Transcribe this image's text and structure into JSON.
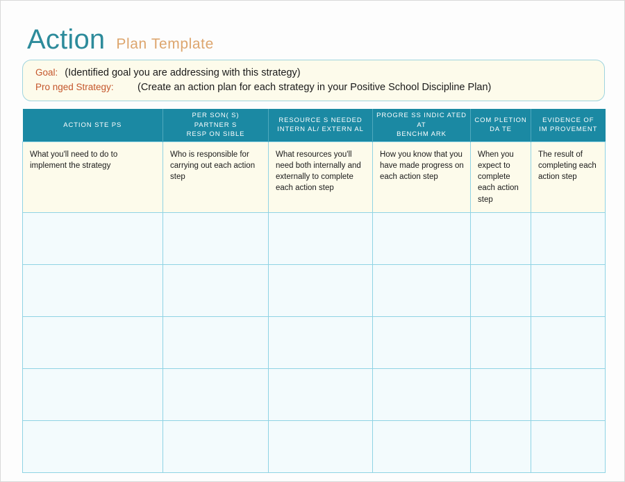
{
  "title": {
    "main": "Action",
    "sub": "Plan  Template"
  },
  "goal": {
    "goal_label": "Goal:",
    "goal_text": "(Identified goal you are addressing with this strategy)",
    "strategy_label": "Pro nged Strategy:",
    "strategy_text": "(Create an action plan for each strategy in your Positive School Discipline Plan)"
  },
  "table": {
    "headers": [
      {
        "lines": [
          "ACTION STE  PS"
        ]
      },
      {
        "lines": [
          "PER SON( S)",
          "PARTNER  S",
          "RESP ON SIBLE"
        ]
      },
      {
        "lines": [
          "RESOURCE  S NEEDED",
          "INTERN  AL/ EXTERN  AL"
        ]
      },
      {
        "lines": [
          "PROGRE  SS INDIC ATED  AT",
          "BENCHM  ARK"
        ]
      },
      {
        "lines": [
          "COM PLETION",
          "DA TE"
        ]
      },
      {
        "lines": [
          "EVIDENCE OF",
          "IM PROVEMENT"
        ]
      }
    ],
    "description_row": [
      "What you'll need to do to implement the strategy",
      "Who is responsible for carrying out each action step",
      "What resources you'll need both internally and externally to complete each action step",
      "How you know that you have made progress on each action step",
      "When you expect to complete each action step",
      "The result of completing each action step"
    ],
    "empty_row_count": 5,
    "column_count": 6
  },
  "colors": {
    "header_teal": "#1b89a3",
    "title_teal": "#2d8b9b",
    "title_orange": "#dda56d",
    "label_orange": "#c4552a",
    "cream": "#fdfbeb",
    "pale_blue": "#f3fbfd",
    "grid_blue": "#8fd3e4"
  }
}
